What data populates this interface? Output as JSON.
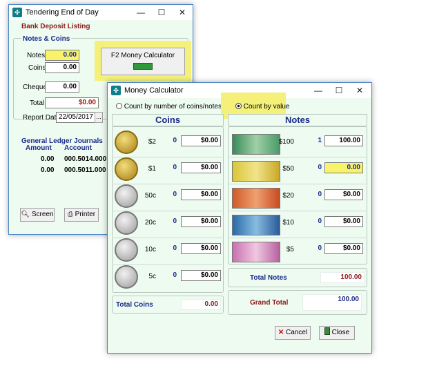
{
  "back_window": {
    "title": "Tendering End of Day",
    "subtitle": "Bank Deposit Listing",
    "section_notes_coins": "Notes & Coins",
    "notes_label": "Notes",
    "notes_value": "0.00",
    "coins_label": "Coins",
    "coins_value": "0.00",
    "cheques_label": "Cheques",
    "cheques_value": "0.00",
    "total_label": "Total",
    "total_value": "$0.00",
    "report_date_label": "Report Date",
    "report_date_value": "22/05/2017",
    "calc_button_label": "F2 Money Calculator",
    "gl_title": "General Ledger Journals",
    "gl_headers": [
      "Amount",
      "Account"
    ],
    "gl_rows": [
      {
        "amount": "0.00",
        "account": "000.5014.000"
      },
      {
        "amount": "0.00",
        "account": "000.5011.000"
      }
    ],
    "screen_button": "Screen",
    "printer_button": "Printer"
  },
  "front_window": {
    "title": "Money Calculator",
    "radio_coins_label": "Count by number of coins/notes",
    "radio_value_label": "Count by value",
    "selected_mode": "Count by value",
    "coins_header": "Coins",
    "notes_header": "Notes",
    "coins": [
      {
        "denom": "$2",
        "count": "0",
        "value": "$0.00"
      },
      {
        "denom": "$1",
        "count": "0",
        "value": "$0.00"
      },
      {
        "denom": "50c",
        "count": "0",
        "value": "$0.00"
      },
      {
        "denom": "20c",
        "count": "0",
        "value": "$0.00"
      },
      {
        "denom": "10c",
        "count": "0",
        "value": "$0.00"
      },
      {
        "denom": "5c",
        "count": "0",
        "value": "$0.00"
      }
    ],
    "notes": [
      {
        "denom": "$100",
        "count": "1",
        "value": "100.00"
      },
      {
        "denom": "$50",
        "count": "0",
        "value": "0.00"
      },
      {
        "denom": "$20",
        "count": "0",
        "value": "$0.00"
      },
      {
        "denom": "$10",
        "count": "0",
        "value": "$0.00"
      },
      {
        "denom": "$5",
        "count": "0",
        "value": "$0.00"
      }
    ],
    "total_coins_label": "Total Coins",
    "total_coins_value": "0.00",
    "total_notes_label": "Total Notes",
    "total_notes_value": "100.00",
    "grand_total_label": "Grand Total",
    "grand_total_value": "100.00",
    "cancel_button": "Cancel",
    "close_button": "Close"
  },
  "colors": {
    "window_bg": "#eefbf1",
    "highlight": "#f4f07a",
    "label_blue": "#1a2a8a",
    "label_red": "#8b1a1a"
  }
}
